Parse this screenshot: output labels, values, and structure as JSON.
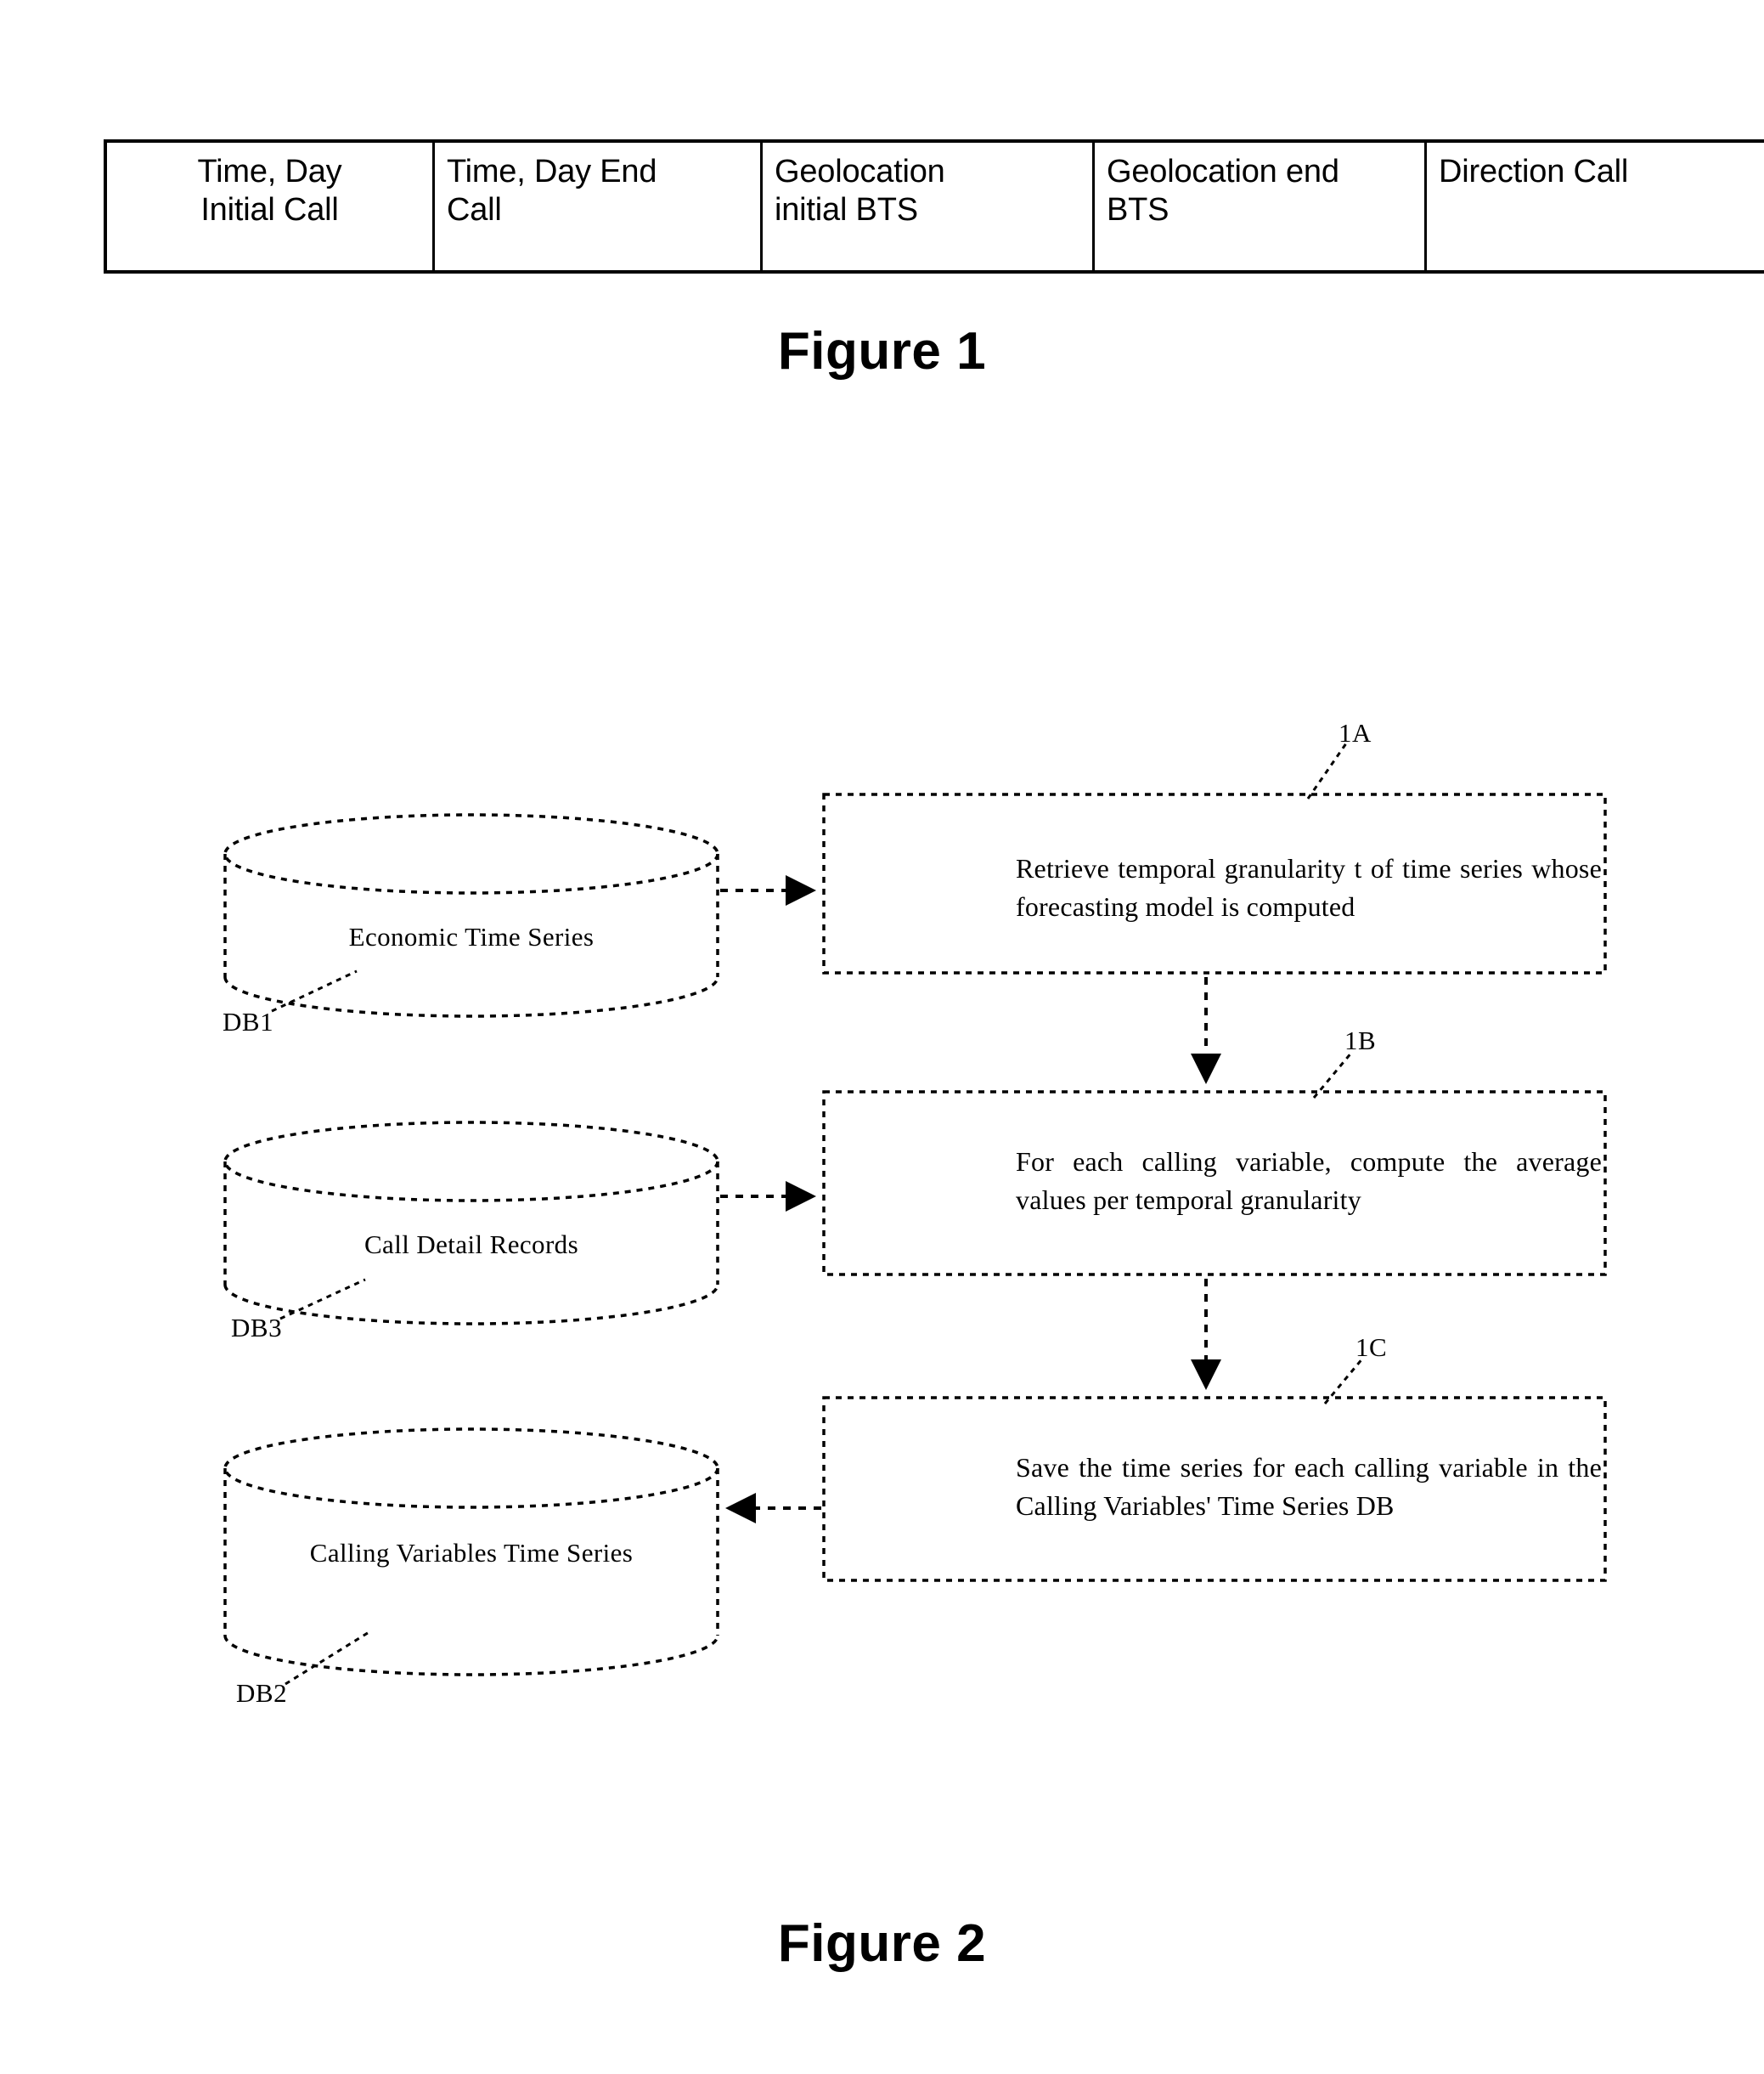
{
  "figure1": {
    "caption": "Figure 1",
    "table": {
      "columns": [
        {
          "id": "time-day-initial-call",
          "lines": [
            "Time, Day",
            "Initial Call"
          ],
          "align": "center",
          "size": "normal"
        },
        {
          "id": "time-day-end-call",
          "lines": [
            "Time, Day End",
            "Call"
          ],
          "align": "left",
          "size": "normal"
        },
        {
          "id": "geolocation-initial-bts",
          "lines": [
            "Geolocation",
            "initial BTS"
          ],
          "align": "left",
          "size": "normal"
        },
        {
          "id": "geolocation-end-bts",
          "lines": [
            "Geolocation end",
            "BTS"
          ],
          "align": "left",
          "size": "small"
        },
        {
          "id": "direction-call",
          "lines": [
            "Direction Call",
            ""
          ],
          "align": "left",
          "size": "normal"
        }
      ],
      "cells": {
        "c1_l1": "Time, Day",
        "c1_l2": "Initial Call",
        "c2_l1": "Time, Day End",
        "c2_l2": "Call",
        "c3_l1": "Geolocation",
        "c3_l2": "initial BTS",
        "c4_l1": "Geolocation end",
        "c4_l2": "BTS",
        "c5_l1": "Direction Call"
      }
    }
  },
  "figure2": {
    "caption": "Figure 2",
    "databases": [
      {
        "ref": "DB1",
        "label": "Economic Time Series"
      },
      {
        "ref": "DB3",
        "label": "Call Detail Records"
      },
      {
        "ref": "DB2",
        "label": "Calling Variables Time Series"
      }
    ],
    "db1": {
      "ref": "DB1",
      "label": "Economic Time Series"
    },
    "db3": {
      "ref": "DB3",
      "label": "Call Detail Records"
    },
    "db2": {
      "ref": "DB2",
      "label": "Calling Variables Time Series"
    },
    "steps": [
      {
        "ref": "1A",
        "text": "Retrieve temporal granularity t of time series whose forecasting model is computed"
      },
      {
        "ref": "1B",
        "text": "For each calling variable, compute the average values per temporal granularity"
      },
      {
        "ref": "1C",
        "text": "Save the time series for each calling variable in the Calling Variables' Time Series DB"
      }
    ],
    "step1a": {
      "ref": "1A",
      "text": "Retrieve temporal granularity t of time series whose forecasting model is computed"
    },
    "step1b": {
      "ref": "1B",
      "text": "For each calling variable, compute the average values per temporal granularity"
    },
    "step1c": {
      "ref": "1C",
      "text": "Save the time series for each calling variable in the Calling Variables' Time Series DB"
    },
    "flow": [
      {
        "from": "DB1",
        "to": "1A",
        "direction": "right"
      },
      {
        "from": "1A",
        "to": "1B",
        "direction": "down"
      },
      {
        "from": "DB3",
        "to": "1B",
        "direction": "right"
      },
      {
        "from": "1B",
        "to": "1C",
        "direction": "down"
      },
      {
        "from": "1C",
        "to": "DB2",
        "direction": "left"
      }
    ]
  },
  "colors": {
    "stroke": "#000000",
    "background": "#ffffff"
  }
}
